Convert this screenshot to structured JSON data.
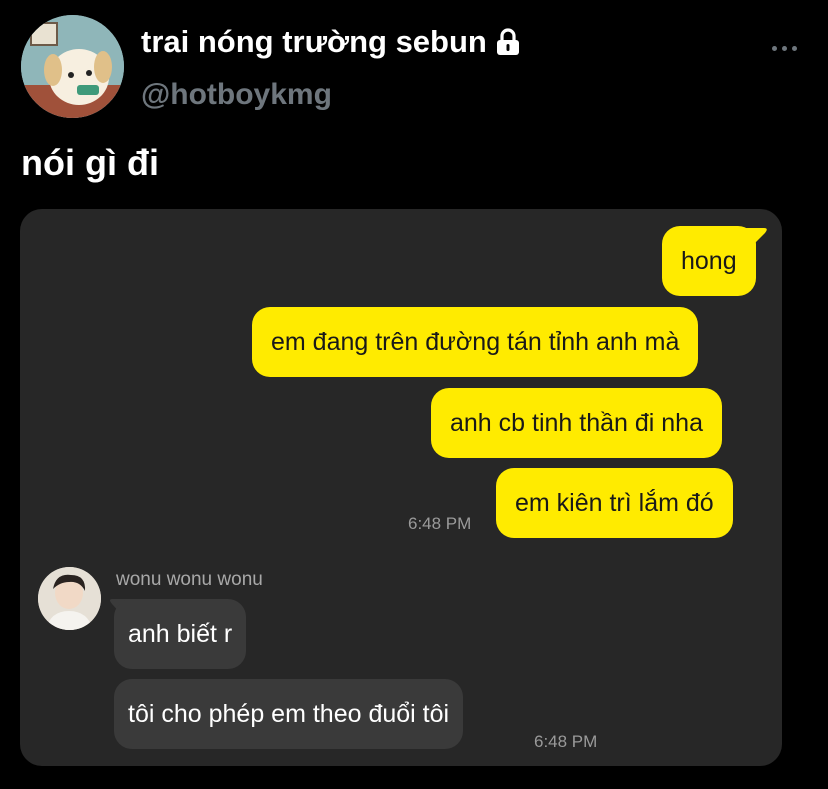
{
  "author": {
    "display_name": "trai nóng trường sebun",
    "handle": "@hotboykmg",
    "protected_icon": "lock-icon"
  },
  "tweet": {
    "text": "nói gì đi"
  },
  "chat": {
    "outgoing": [
      {
        "text": "hong"
      },
      {
        "text": "em đang trên đường tán tỉnh anh mà"
      },
      {
        "text": "anh cb tinh thần đi nha"
      },
      {
        "text": "em kiên trì lắm đó"
      }
    ],
    "outgoing_time": "6:48 PM",
    "sender_name": "wonu wonu wonu",
    "incoming": [
      {
        "text": "anh biết r"
      },
      {
        "text": "tôi cho phép em theo đuổi tôi"
      }
    ],
    "incoming_time": "6:48 PM"
  },
  "colors": {
    "outgoing_bubble": "#ffeb00",
    "incoming_bubble": "#3a3a3a",
    "chat_background": "#272727",
    "handle_gray": "#6e767d"
  }
}
